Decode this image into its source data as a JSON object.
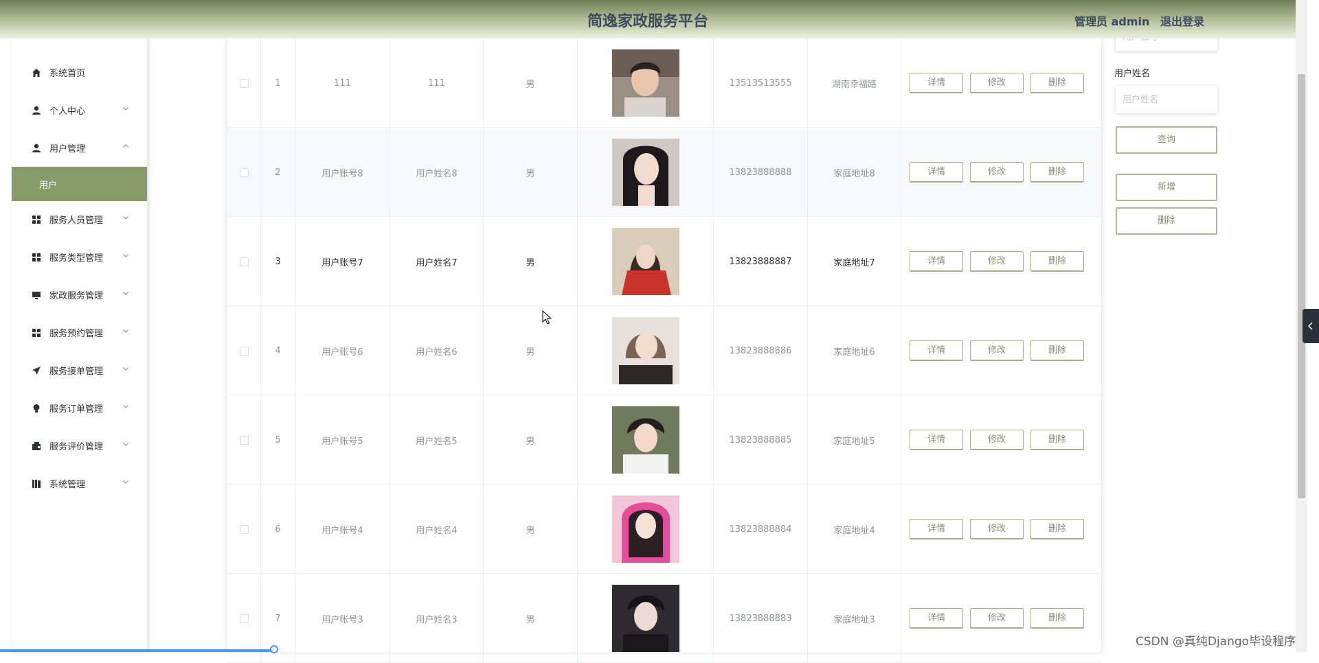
{
  "header": {
    "title": "简逸家政服务平台",
    "user": "管理员 admin",
    "logout": "退出登录"
  },
  "sidebar": {
    "items": [
      {
        "label": "系统首页",
        "icon": "home-icon"
      },
      {
        "label": "个人中心",
        "icon": "person-icon"
      },
      {
        "label": "用户管理",
        "icon": "person-icon"
      },
      {
        "label": "服务人员管理",
        "icon": "grid-icon"
      },
      {
        "label": "服务类型管理",
        "icon": "grid-icon"
      },
      {
        "label": "家政服务管理",
        "icon": "monitor-icon"
      },
      {
        "label": "服务预约管理",
        "icon": "grid-icon"
      },
      {
        "label": "服务接单管理",
        "icon": "send-icon"
      },
      {
        "label": "服务订单管理",
        "icon": "bulb-icon"
      },
      {
        "label": "服务评价管理",
        "icon": "wallet-icon"
      },
      {
        "label": "系统管理",
        "icon": "book-icon"
      }
    ],
    "active_sub": "用户"
  },
  "table": {
    "rows": [
      {
        "index": "1",
        "account": "111",
        "name": "111",
        "gender": "男",
        "phone": "13513513555",
        "address": "湖南幸福路"
      },
      {
        "index": "2",
        "account": "用户账号8",
        "name": "用户姓名8",
        "gender": "男",
        "phone": "13823888888",
        "address": "家庭地址8"
      },
      {
        "index": "3",
        "account": "用户账号7",
        "name": "用户姓名7",
        "gender": "男",
        "phone": "13823888887",
        "address": "家庭地址7"
      },
      {
        "index": "4",
        "account": "用户账号6",
        "name": "用户姓名6",
        "gender": "男",
        "phone": "13823888886",
        "address": "家庭地址6"
      },
      {
        "index": "5",
        "account": "用户账号5",
        "name": "用户姓名5",
        "gender": "男",
        "phone": "13823888885",
        "address": "家庭地址5"
      },
      {
        "index": "6",
        "account": "用户账号4",
        "name": "用户姓名4",
        "gender": "男",
        "phone": "13823888884",
        "address": "家庭地址4"
      },
      {
        "index": "7",
        "account": "用户账号3",
        "name": "用户姓名3",
        "gender": "男",
        "phone": "13823888883",
        "address": "家庭地址3"
      }
    ],
    "actions": {
      "detail": "详情",
      "edit": "修改",
      "delete": "删除"
    }
  },
  "search": {
    "account_placeholder": "用户账号",
    "name_label": "用户姓名",
    "name_placeholder": "用户姓名",
    "query": "查询",
    "add": "新增",
    "delete": "删除"
  },
  "watermark": "CSDN @真纯Django毕设程序",
  "colors": {
    "accent": "#879a68",
    "header_dark": "#6e7d56",
    "button_border": "#a9ad8e"
  }
}
